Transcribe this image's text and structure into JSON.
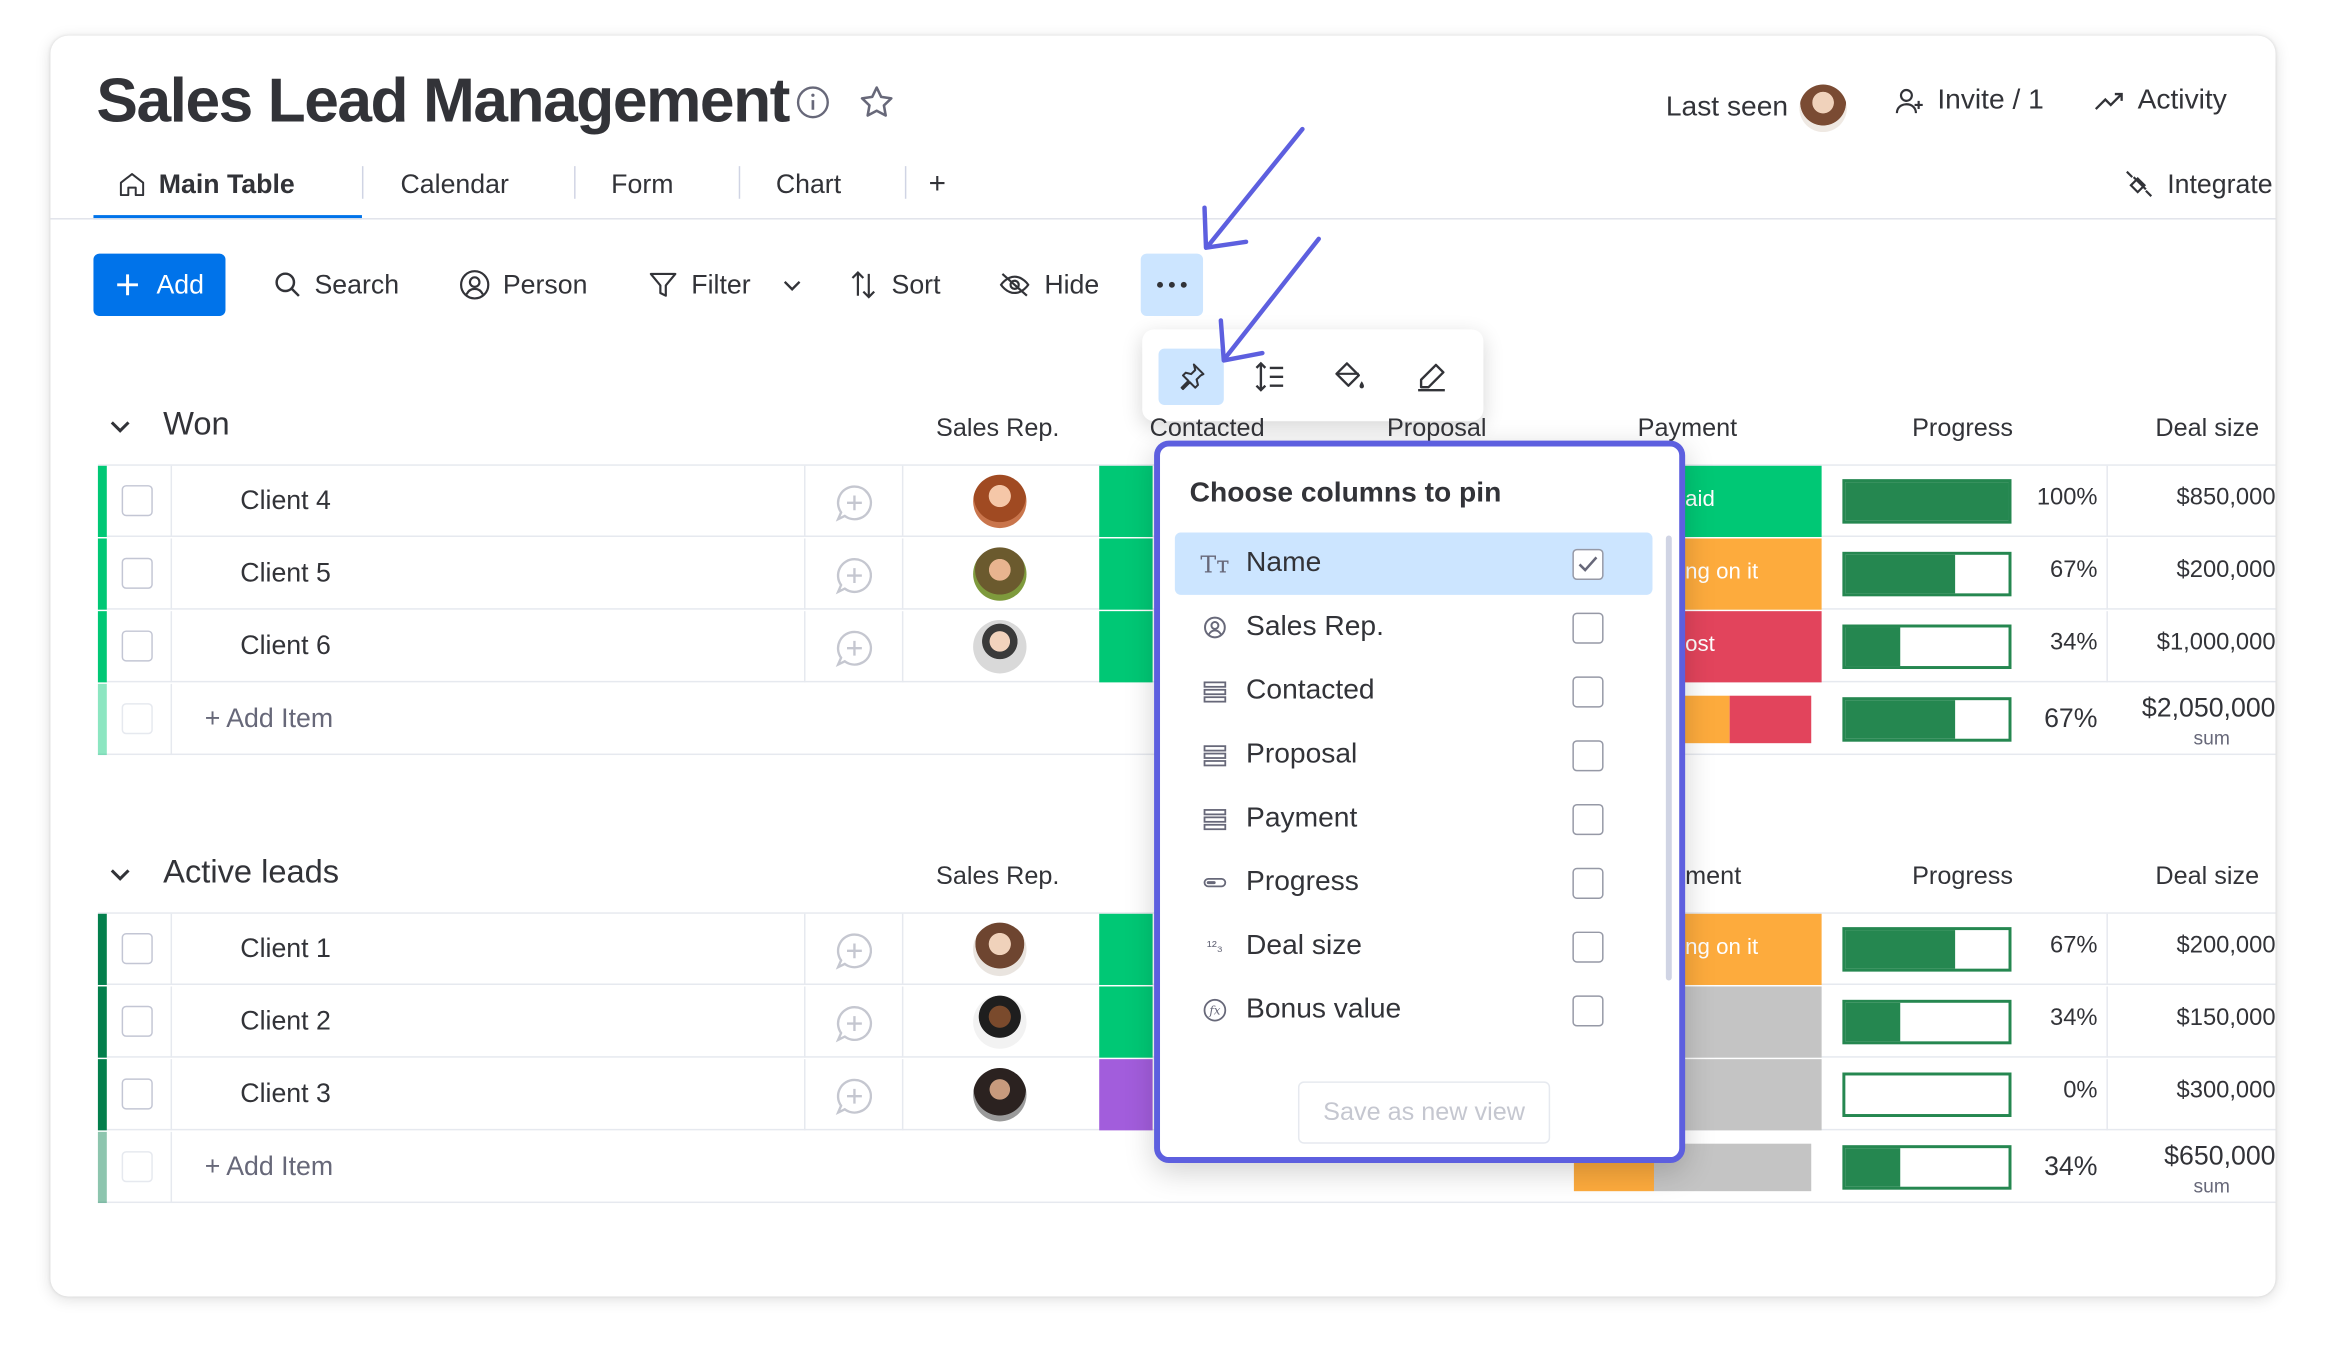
{
  "header": {
    "title": "Sales Lead Management",
    "last_seen_label": "Last seen",
    "invite_label": "Invite / 1",
    "activity_label": "Activity"
  },
  "tabs": [
    {
      "label": "Main Table",
      "active": true
    },
    {
      "label": "Calendar"
    },
    {
      "label": "Form"
    },
    {
      "label": "Chart"
    },
    {
      "label": "+"
    }
  ],
  "integrate_label": "Integrate",
  "toolbar": {
    "add_label": "Add",
    "search_label": "Search",
    "person_label": "Person",
    "filter_label": "Filter",
    "sort_label": "Sort",
    "hide_label": "Hide"
  },
  "colors": {
    "accent": "#0073ea",
    "won": "#00c875",
    "active": "#037f4c",
    "done": "#00c875",
    "working": "#fdab3d",
    "stuck": "#e2445c",
    "purple": "#a25ddc",
    "grey": "#c4c4c4",
    "progress": "#258750",
    "highlight": "#5d5fdf"
  },
  "groups": [
    {
      "title": "Won",
      "color": "#00c875",
      "columns": {
        "sales_rep": "Sales Rep.",
        "contacted": "Contacted",
        "proposal": "Proposal",
        "payment": "Payment",
        "progress": "Progress",
        "deal_size": "Deal size"
      },
      "rows": [
        {
          "name": "Client 4",
          "payment": "aid",
          "payment_color": "#00c875",
          "progress": 100,
          "progress_label": "100%",
          "deal": "$850,000"
        },
        {
          "name": "Client 5",
          "payment": "ng on it",
          "payment_color": "#fdab3d",
          "progress": 67,
          "progress_label": "67%",
          "deal": "$200,000"
        },
        {
          "name": "Client 6",
          "payment": "ost",
          "payment_color": "#e2445c",
          "progress": 34,
          "progress_label": "34%",
          "deal": "$1,000,000"
        }
      ],
      "add_item": "+ Add Item",
      "summary": {
        "progress": 67,
        "progress_label": "67%",
        "deal": "$2,050,000",
        "deal_sub": "sum"
      }
    },
    {
      "title": "Active leads",
      "color": "#037f4c",
      "columns": {
        "sales_rep": "Sales Rep.",
        "payment": "ment",
        "progress": "Progress",
        "deal_size": "Deal size"
      },
      "rows": [
        {
          "name": "Client 1",
          "payment": "ng on it",
          "payment_color": "#fdab3d",
          "progress": 67,
          "progress_label": "67%",
          "deal": "$200,000"
        },
        {
          "name": "Client 2",
          "payment": "",
          "payment_color": "#c4c4c4",
          "progress": 34,
          "progress_label": "34%",
          "deal": "$150,000"
        },
        {
          "name": "Client 3",
          "payment": "",
          "payment_color": "#c4c4c4",
          "progress": 0,
          "progress_label": "0%",
          "deal": "$300,000"
        }
      ],
      "add_item": "+ Add Item",
      "summary": {
        "progress": 34,
        "progress_label": "34%",
        "deal": "$650,000",
        "deal_sub": "sum"
      }
    }
  ],
  "pin_dropdown": {
    "title": "Choose columns to pin",
    "items": [
      {
        "label": "Name",
        "icon": "text-icon",
        "checked": true
      },
      {
        "label": "Sales Rep.",
        "icon": "person-icon",
        "checked": false
      },
      {
        "label": "Contacted",
        "icon": "status-icon",
        "checked": false
      },
      {
        "label": "Proposal",
        "icon": "status-icon",
        "checked": false
      },
      {
        "label": "Payment",
        "icon": "status-icon",
        "checked": false
      },
      {
        "label": "Progress",
        "icon": "progress-icon",
        "checked": false
      },
      {
        "label": "Deal size",
        "icon": "numbers-icon",
        "checked": false
      },
      {
        "label": "Bonus value",
        "icon": "formula-icon",
        "checked": false
      }
    ],
    "save_label": "Save as new view"
  }
}
